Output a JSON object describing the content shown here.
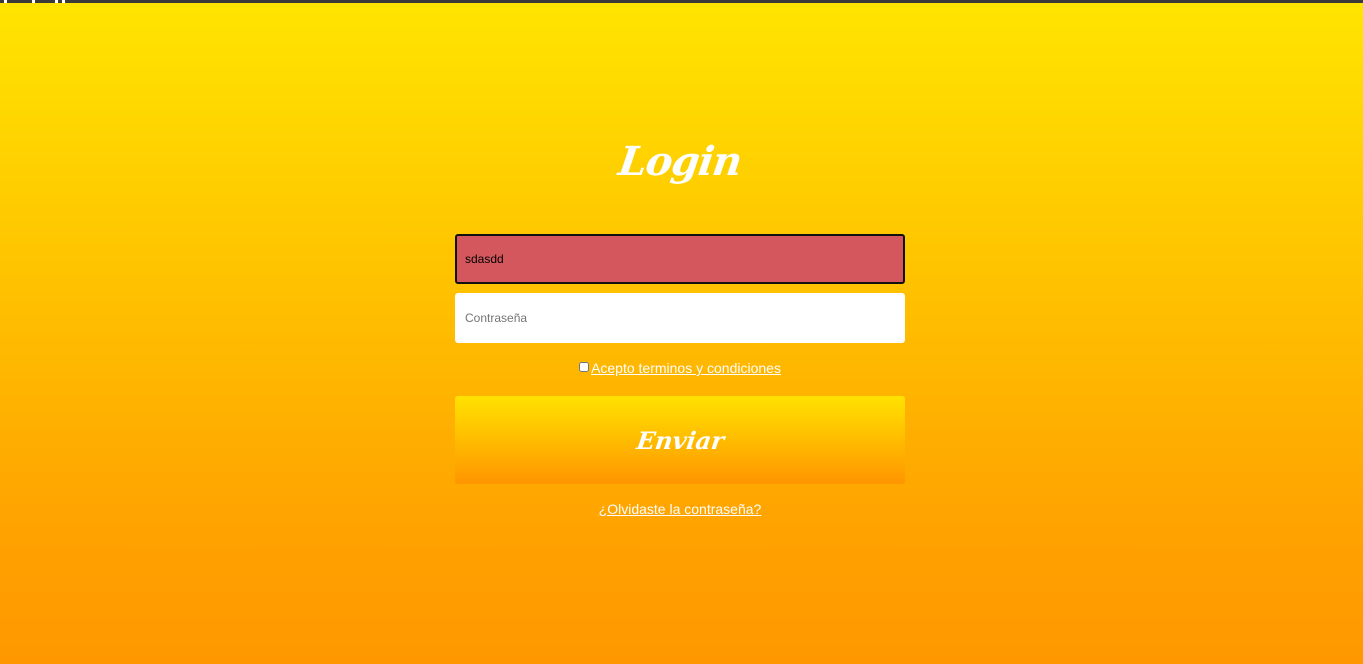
{
  "page": {
    "title": "Login"
  },
  "form": {
    "username": {
      "value": "sdasdd",
      "placeholder": ""
    },
    "password": {
      "value": "",
      "placeholder": "Contraseña"
    },
    "terms": {
      "label": "Acepto terminos y condiciones",
      "checked": false
    },
    "submit_label": "Enviar",
    "forgot_label": "¿Olvidaste la contraseña?"
  },
  "colors": {
    "background_top": "#ffe500",
    "background_bottom": "#ff9800",
    "username_field_bg": "#d4575e",
    "text": "#ffffff"
  }
}
